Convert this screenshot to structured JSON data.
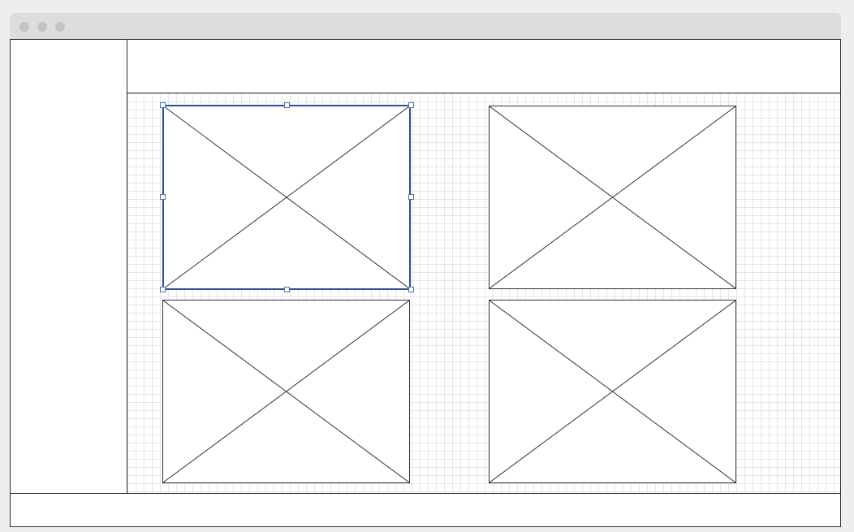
{
  "window": {
    "traffic_lights": [
      "close-dot",
      "minimize-dot",
      "zoom-dot"
    ]
  },
  "colors": {
    "selection": "#2a4f9c",
    "handle": "#4a74b8",
    "grid": "#e6e6e6",
    "titlebar": "#dddddd"
  },
  "canvas": {
    "grid": true,
    "image_placeholders": 4,
    "selected_placeholder": 1
  }
}
